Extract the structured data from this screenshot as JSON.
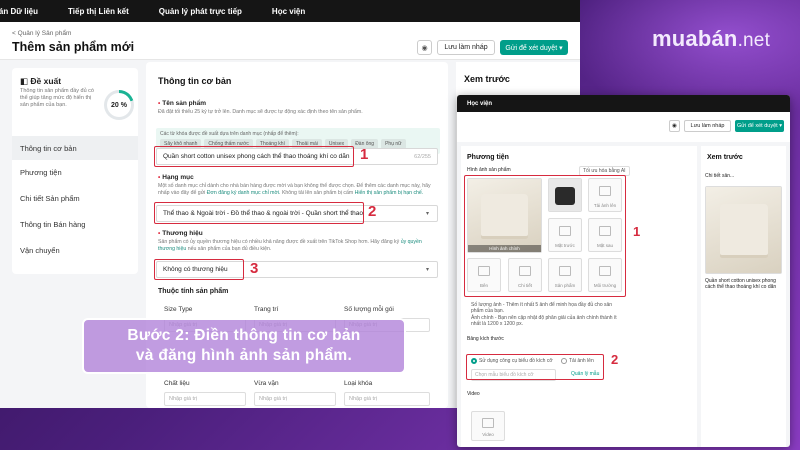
{
  "brand": {
    "logo_main": "muabán",
    "logo_tld": ".net"
  },
  "main": {
    "nav": [
      "bán Dữ liệu",
      "Tiếp thị Liên kết",
      "Quản lý phát trực tiếp",
      "Học viện"
    ],
    "breadcrumb": "< Quản lý Sản phẩm",
    "page_title": "Thêm sản phẩm mới",
    "header_buttons": {
      "icon": "◉",
      "draft": "Lưu làm nháp",
      "submit": "Gửi để xét duyệt ▾"
    },
    "sidebar": {
      "suggest_title": "Đề xuất",
      "suggest_desc": "Thông tin sản phẩm đầy đủ có thể giúp tăng mức độ hiển thị sản phẩm của bạn.",
      "progress_label": "20 %",
      "progress_value": 0.2,
      "items": [
        "Thông tin cơ bản",
        "Phương tiện",
        "Chi tiết Sản phẩm",
        "Thông tin Bán hàng",
        "Vận chuyển"
      ]
    },
    "form": {
      "section_title": "Thông tin cơ bản",
      "name": {
        "label": "Tên sản phẩm",
        "hint": "Đã đặt tối thiểu 25 ký tự trở lên. Danh mục sẽ được tự động xác định theo tên sản phẩm.",
        "suggest_text": "Các từ khóa được đề xuất dựa trên danh mục (nhấp để thêm):",
        "chips": [
          "Sây khô nhanh",
          "Chống thấm nước",
          "Thoáng khí",
          "Thoải mái",
          "Unisex",
          "Đàn ông",
          "Phụ nữ"
        ],
        "value": "Quần short cotton unisex phong cách thể thao thoáng khí co dãn",
        "counter": "62/255"
      },
      "category": {
        "label": "Hạng mục",
        "hint1": "Một số danh mục chỉ dành cho nhà bán hàng được mời và bạn không thể được chọn. Để thêm các danh mục này,",
        "hint2": "hãy nhấp vào đây để gửi",
        "hint_link1": "Đơn đăng ký danh mục chỉ mời.",
        "hint3": "Không tải lên sản phẩm bị cấm",
        "hint_link2": "Hiển thị sản phẩm bị hạn chế.",
        "value": "Thể thao & Ngoài trời - Đồ thể thao & ngoài trời - Quần short thể thao"
      },
      "brand": {
        "label": "Thương hiệu",
        "hint": "Sản phẩm có ủy quyền thương hiệu có nhiều khả năng được đề xuất trên TikTok Shop hơn. Hãy đăng ký",
        "hint_link": "ủy quyền thương hiệu",
        "hint_end": "nếu sản phẩm của bạn đủ điều kiện.",
        "value": "Không có thương hiệu"
      },
      "attributes": {
        "title": "Thuộc tính sản phẩm",
        "cols_row1": [
          "Size Type",
          "Trang trí",
          "Số lượng mỗi gói"
        ],
        "cols_row2": [
          "Chất liệu",
          "Vừa vặn",
          "Loại khóa"
        ],
        "placeholder": "Nhập giá trị"
      }
    },
    "preview_title": "Xem trước",
    "markers": [
      "1",
      "2",
      "3"
    ]
  },
  "caption": {
    "line1": "Bước 2: Điền thông tin cơ bản",
    "line2": "và đăng hình ảnh sản phẩm."
  },
  "second": {
    "nav": "Học viện",
    "buttons": {
      "draft": "Lưu làm nháp",
      "submit": "Gửi để xét duyệt ▾"
    },
    "section_title": "Phương tiện",
    "images_label": "Hình ảnh sản phẩm",
    "ai_btn": "Tối ưu hóa bằng AI",
    "main_img_label": "Hình ảnh chính",
    "upload_label": "Tải ảnh lên",
    "cells": [
      "Mặt trước",
      "Mặt sau",
      "Bên",
      "Chi tiết",
      "Sản phẩm",
      "Môi trường"
    ],
    "notes": [
      "Số lượng ảnh - Thêm ít nhất 5 ảnh để minh họa đầy đủ cho sản phẩm của bạn.",
      "Ảnh chính - Bạn nên cập nhật độ phân giải của ảnh chính thành ít nhất là 1200 x 1200 px."
    ],
    "size_chart_label": "Bảng kích thước",
    "radio1": "Sử dụng công cụ biểu đồ kích cỡ",
    "radio2": "Tải ảnh lên",
    "size_select": "Chọn mẫu biểu đồ kích cỡ",
    "size_manage": "Quản lý mẫu",
    "video_label": "Video",
    "video_btn": "Video",
    "preview_title": "Xem trước",
    "preview_sub": "Chi tiết sản...",
    "preview_product": "Quần short cotton unisex phong cách thể thao thoáng khí co dãn",
    "markers": [
      "1",
      "2"
    ]
  }
}
